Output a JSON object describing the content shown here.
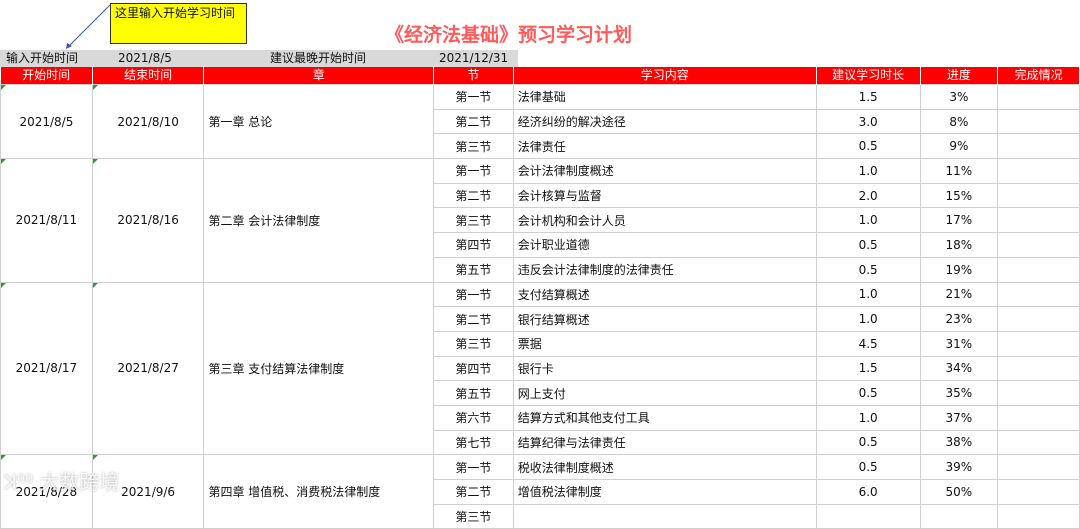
{
  "note": "这里输入开始学习时间",
  "title": "《经济法基础》预习学习计划",
  "input_bar": {
    "start_label": "输入开始时间",
    "start_value": "2021/8/5",
    "latest_label": "建议最晚开始时间",
    "latest_value": "2021/12/31"
  },
  "headers": [
    "开始时间",
    "结束时间",
    "章",
    "节",
    "学习内容",
    "建议学习时长",
    "进度",
    "完成情况"
  ],
  "chapters": [
    {
      "start": "2021/8/5",
      "end": "2021/8/10",
      "chapter": "第一章 总论",
      "sections": [
        {
          "section": "第一节",
          "content": "法律基础",
          "hours": "1.5",
          "progress": "3%",
          "status": ""
        },
        {
          "section": "第二节",
          "content": "经济纠纷的解决途径",
          "hours": "3.0",
          "progress": "8%",
          "status": ""
        },
        {
          "section": "第三节",
          "content": "法律责任",
          "hours": "0.5",
          "progress": "9%",
          "status": ""
        }
      ]
    },
    {
      "start": "2021/8/11",
      "end": "2021/8/16",
      "chapter": "第二章 会计法律制度",
      "sections": [
        {
          "section": "第一节",
          "content": "会计法律制度概述",
          "hours": "1.0",
          "progress": "11%",
          "status": ""
        },
        {
          "section": "第二节",
          "content": "会计核算与监督",
          "hours": "2.0",
          "progress": "15%",
          "status": ""
        },
        {
          "section": "第三节",
          "content": "会计机构和会计人员",
          "hours": "1.0",
          "progress": "17%",
          "status": ""
        },
        {
          "section": "第四节",
          "content": "会计职业道德",
          "hours": "0.5",
          "progress": "18%",
          "status": ""
        },
        {
          "section": "第五节",
          "content": "违反会计法律制度的法律责任",
          "hours": "0.5",
          "progress": "19%",
          "status": ""
        }
      ]
    },
    {
      "start": "2021/8/17",
      "end": "2021/8/27",
      "chapter": "第三章   支付结算法律制度",
      "sections": [
        {
          "section": "第一节",
          "content": "支付结算概述",
          "hours": "1.0",
          "progress": "21%",
          "status": ""
        },
        {
          "section": "第二节",
          "content": "银行结算概述",
          "hours": "1.0",
          "progress": "23%",
          "status": ""
        },
        {
          "section": "第三节",
          "content": "票据",
          "hours": "4.5",
          "progress": "31%",
          "status": ""
        },
        {
          "section": "第四节",
          "content": "银行卡",
          "hours": "1.5",
          "progress": "34%",
          "status": ""
        },
        {
          "section": "第五节",
          "content": "网上支付",
          "hours": "0.5",
          "progress": "35%",
          "status": ""
        },
        {
          "section": "第六节",
          "content": "结算方式和其他支付工具",
          "hours": "1.0",
          "progress": "37%",
          "status": ""
        },
        {
          "section": "第七节",
          "content": "结算纪律与法律责任",
          "hours": "0.5",
          "progress": "38%",
          "status": ""
        }
      ]
    },
    {
      "start": "2021/8/28",
      "end": "2021/9/6",
      "chapter": "第四章 增值税、消费税法律制度",
      "sections": [
        {
          "section": "第一节",
          "content": "税收法律制度概述",
          "hours": "0.5",
          "progress": "39%",
          "status": ""
        },
        {
          "section": "第二节",
          "content": "增值税法律制度",
          "hours": "6.0",
          "progress": "50%",
          "status": ""
        },
        {
          "section": "第三节",
          "content": "",
          "hours": "",
          "progress": "",
          "status": ""
        }
      ]
    }
  ],
  "watermark": "大数跨境"
}
